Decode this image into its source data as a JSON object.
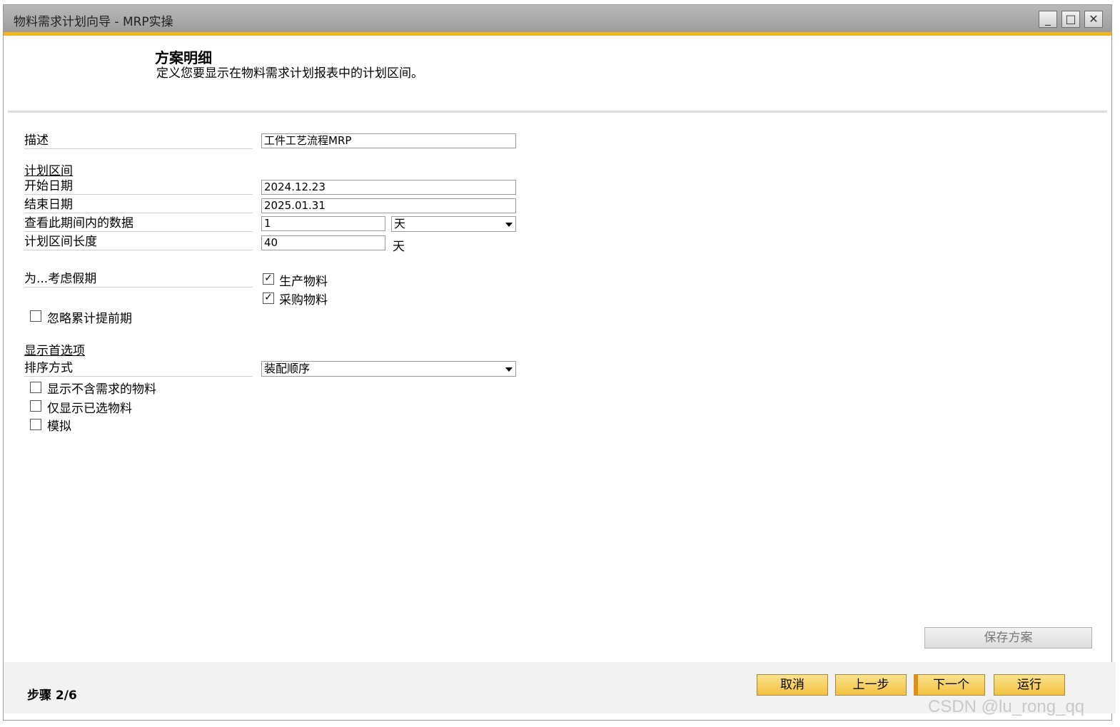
{
  "window": {
    "title": "物料需求计划向导 - MRP实操",
    "min_icon": "minimize-icon",
    "max_icon": "maximize-icon",
    "close_icon": "close-icon"
  },
  "header": {
    "title": "方案明细",
    "subtitle": "定义您要显示在物料需求计划报表中的计划区间。"
  },
  "form": {
    "description_label": "描述",
    "description_value": "工件工艺流程MRP",
    "planning_section": "计划区间",
    "start_date_label": "开始日期",
    "start_date_value": "2024.12.23",
    "end_date_label": "结束日期",
    "end_date_value": "2025.01.31",
    "view_period_label": "查看此期间内的数据",
    "view_period_value": "1",
    "view_period_unit": "天",
    "period_length_label": "计划区间长度",
    "period_length_value": "40",
    "period_length_unit": "天",
    "holidays_label": "为...考虑假期",
    "production_items": "生产物料",
    "purchase_items": "采购物料",
    "ignore_lead_time": "忽略累计提前期",
    "display_section": "显示首选项",
    "sort_label": "排序方式",
    "sort_value": "装配顺序",
    "show_no_demand": "显示不含需求的物料",
    "show_selected_only": "仅显示已选物料",
    "simulate": "模拟"
  },
  "checkbox_state": {
    "production_items": true,
    "purchase_items": true,
    "ignore_lead_time": false,
    "show_no_demand": false,
    "show_selected_only": false,
    "simulate": false
  },
  "footer": {
    "save_scenario": "保存方案",
    "step": "步骤 2/6",
    "cancel": "取消",
    "prev": "上一步",
    "next": "下一个",
    "run": "运行"
  },
  "watermark": "CSDN @lu_rong_qq",
  "colors": {
    "accent": "#f2b61c",
    "button": "#f2c23e"
  }
}
